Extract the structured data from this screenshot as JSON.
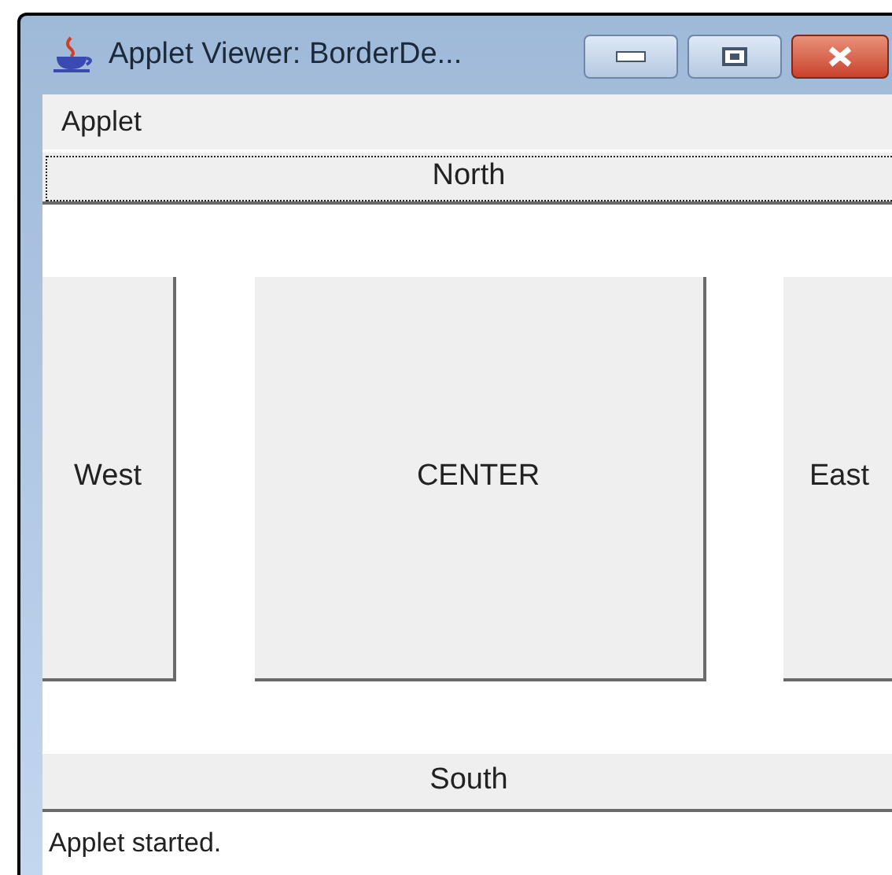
{
  "window": {
    "title": "Applet Viewer: BorderDe..."
  },
  "menu_bar": {
    "items": [
      "Applet"
    ]
  },
  "buttons": [
    {
      "kind": "north",
      "label": "North",
      "focused": true
    },
    {
      "kind": "west",
      "label": "West",
      "focused": false
    },
    {
      "kind": "center",
      "label": "CENTER",
      "focused": false
    },
    {
      "kind": "east",
      "label": "East",
      "focused": false
    },
    {
      "kind": "south",
      "label": "South",
      "focused": false
    }
  ],
  "status_bar": {
    "text": "Applet started."
  }
}
